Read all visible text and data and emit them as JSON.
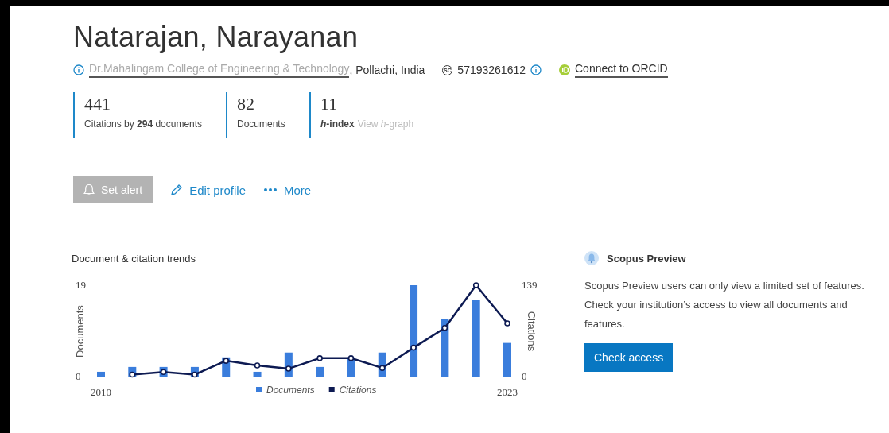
{
  "profile": {
    "name": "Natarajan, Narayanan",
    "institution": "Dr.Mahalingam College of Engineering & Technology",
    "location": ", Pollachi, India",
    "id_badge": "SC",
    "scopus_id": "57193261612",
    "orcid_link": "Connect to ORCID"
  },
  "metrics": [
    {
      "value": "441",
      "label": "Citations by **294** documents"
    },
    {
      "value": "82",
      "label": "Documents"
    },
    {
      "value": "11",
      "label": "*h*-index",
      "link": "View *h*-graph"
    }
  ],
  "actions": [
    {
      "kind": "button",
      "label": "Set alert",
      "disabled": true
    },
    {
      "kind": "edit",
      "label": "Edit profile"
    },
    {
      "kind": "more",
      "label": "More"
    }
  ],
  "trends": {
    "title": "Document & citation trends",
    "charts": [
      {
        "chart_data": {
          "type": "bar",
          "ylabel": "Documents",
          "x": [
            2010,
            2011,
            2012,
            2013,
            2014,
            2015,
            2016,
            2017,
            2018,
            2019,
            2020,
            2021,
            2022,
            2023
          ],
          "xlim": [
            2010,
            2023
          ],
          "xticks": [
            2010,
            2023
          ],
          "yticks": [
            0,
            19
          ],
          "ylim": [
            0,
            19
          ],
          "series": [
            {
              "name": "Documents",
              "color": "#3a7ddc",
              "values": [
                1,
                2,
                2,
                2,
                4,
                1,
                5,
                2,
                4,
                5,
                19,
                12,
                16,
                7
              ]
            }
          ]
        }
      },
      {
        "chart_data": {
          "type": "line",
          "ylabel": "Citations",
          "yticks": [
            0,
            139
          ],
          "ylim": [
            0,
            139
          ],
          "series": [
            {
              "name": "Citations",
              "color": "#0d1a52",
              "marker": "circle",
              "values": [
                null,
                3,
                7,
                3,
                24,
                17,
                12,
                28,
                28,
                13,
                44,
                74,
                139,
                81
              ]
            }
          ]
        }
      }
    ]
  },
  "preview": {
    "title": "Scopus Preview",
    "message": "Scopus Preview users can only view a limited set of features. Check your institution’s access to view all documents and features.",
    "button": "Check access"
  }
}
